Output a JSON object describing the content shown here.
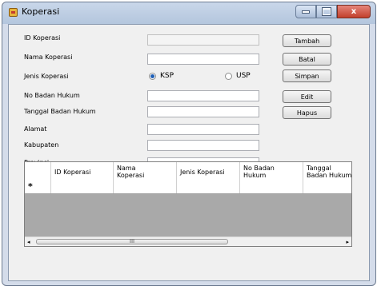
{
  "window": {
    "title": "Koperasi",
    "controls": {
      "minimize": "minimize-icon",
      "maximize": "maximize-icon",
      "close": "x"
    }
  },
  "form": {
    "labels": {
      "id": "ID Koperasi",
      "nama": "Nama Koperasi",
      "jenis": "Jenis Koperasi",
      "no_badan": "No Badan Hukum",
      "tanggal": "Tanggal Badan Hukum",
      "alamat": "Alamat",
      "kabupaten": "Kabupaten",
      "provinsi": "Provinsi"
    },
    "values": {
      "id": "",
      "nama": "",
      "no_badan": "",
      "tanggal": "",
      "alamat": "",
      "kabupaten": "",
      "provinsi": ""
    },
    "jenis_options": [
      {
        "label": "KSP",
        "selected": true
      },
      {
        "label": "USP",
        "selected": false
      }
    ]
  },
  "buttons": {
    "tambah": "Tambah",
    "batal": "Batal",
    "simpan": "Simpan",
    "edit": "Edit",
    "hapus": "Hapus"
  },
  "grid": {
    "columns": [
      "ID Koperasi",
      "Nama\nKoperasi",
      "Jenis Koperasi",
      "No Badan\nHukum",
      "Tanggal\nBadan Hukum"
    ],
    "new_row_marker": "*",
    "scrollbar_thumb_grip": "III",
    "scroll_left": "◂",
    "scroll_right": "▸"
  },
  "colors": {
    "accent": "#1f5fb5",
    "close_button": "#c2402c",
    "grid_background": "#a9a9a9"
  }
}
